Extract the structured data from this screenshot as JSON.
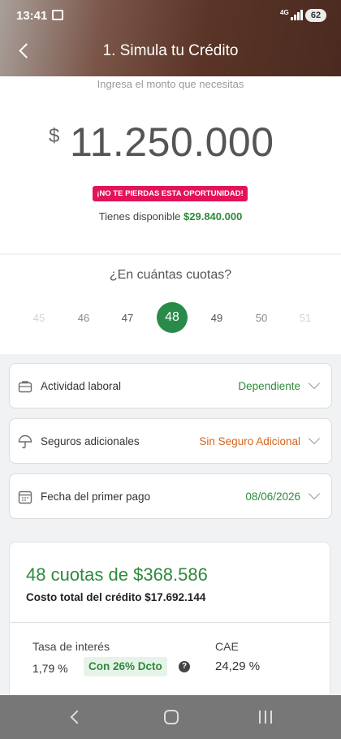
{
  "status_bar": {
    "time": "13:41",
    "network": "4G",
    "battery": "62"
  },
  "header": {
    "title": "1. Simula tu Crédito"
  },
  "amount": {
    "hint": "Ingresa el monto que necesitas",
    "currency": "$",
    "value": "11.250.000",
    "promo": "¡NO TE PIERDAS ESTA OPORTUNIDAD!",
    "available_label": "Tienes disponible",
    "available_value": "$29.840.000"
  },
  "cuotas": {
    "question": "¿En cuántas cuotas?",
    "options": [
      {
        "label": "45",
        "color": "#d4d4d4"
      },
      {
        "label": "46",
        "color": "#8a8a8a"
      },
      {
        "label": "47",
        "color": "#555555"
      },
      {
        "label": "48",
        "selected": true
      },
      {
        "label": "49",
        "color": "#555555"
      },
      {
        "label": "50",
        "color": "#8a8a8a"
      },
      {
        "label": "51",
        "color": "#d4d4d4"
      }
    ]
  },
  "options": {
    "actividad": {
      "label": "Actividad laboral",
      "value": "Dependiente",
      "icon": "briefcase-icon"
    },
    "seguros": {
      "label": "Seguros adicionales",
      "value": "Sin Seguro Adicional",
      "icon": "umbrella-icon"
    },
    "fecha": {
      "label": "Fecha del primer pago",
      "value": "08/06/2026",
      "icon": "calendar-icon"
    }
  },
  "summary": {
    "headline": "48 cuotas de $368.586",
    "total": "Costo total del crédito $17.692.144",
    "tasa_label": "Tasa de interés",
    "tasa_value": "1,79 %",
    "discount": "Con 26% Dcto",
    "help": "?",
    "cae_label": "CAE",
    "cae_value": "24,29 %"
  },
  "colors": {
    "accent_green": "#2e8a3c",
    "promo_pink": "#e2135a",
    "orange": "#d9621a"
  }
}
